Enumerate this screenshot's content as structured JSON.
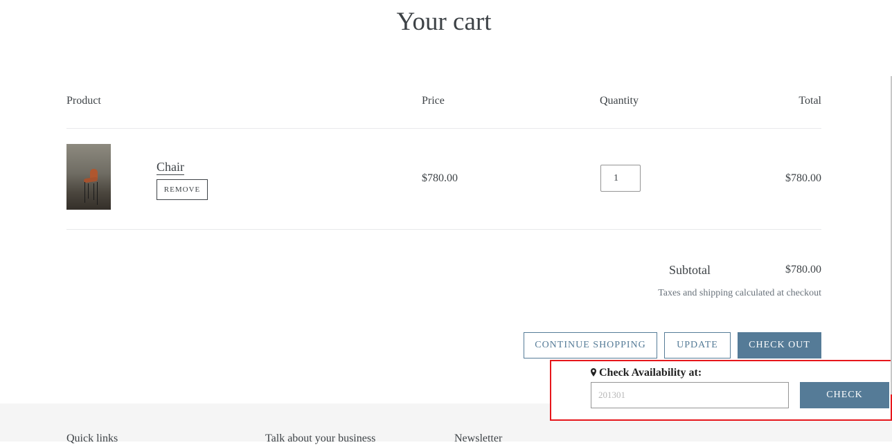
{
  "page": {
    "title": "Your cart"
  },
  "table": {
    "headers": {
      "product": "Product",
      "price": "Price",
      "quantity": "Quantity",
      "total": "Total"
    },
    "items": [
      {
        "name": "Chair",
        "remove_label": "REMOVE",
        "price": "$780.00",
        "quantity": "1",
        "total": "$780.00",
        "image_alt": "Chair"
      }
    ]
  },
  "summary": {
    "subtotal_label": "Subtotal",
    "subtotal_value": "$780.00",
    "note": "Taxes and shipping calculated at checkout"
  },
  "actions": {
    "continue_label": "CONTINUE SHOPPING",
    "update_label": "UPDATE",
    "checkout_label": "CHECK OUT"
  },
  "availability": {
    "label": "Check Availability at:",
    "placeholder": "201301",
    "button_label": "CHECK",
    "icon": "map-marker-icon"
  },
  "footer": {
    "quick_links": "Quick links",
    "talk": "Talk about your business",
    "newsletter": "Newsletter"
  },
  "colors": {
    "accent": "#557b97",
    "highlight_border": "#e6161b",
    "text": "#3d4246",
    "footer_bg": "#f5f5f5"
  }
}
